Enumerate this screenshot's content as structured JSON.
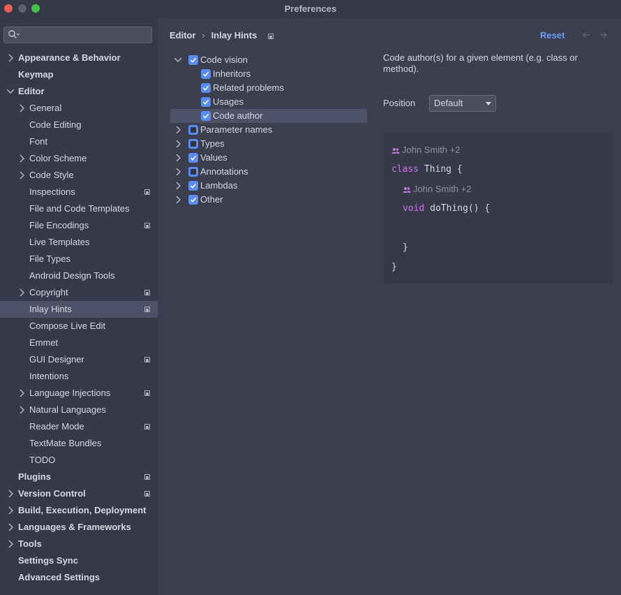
{
  "window": {
    "title": "Preferences"
  },
  "search": {
    "placeholder": ""
  },
  "sidebar": {
    "items": [
      {
        "label": "Appearance & Behavior",
        "bold": true,
        "chevron": "right",
        "level": 0,
        "badge": false,
        "selected": false
      },
      {
        "label": "Keymap",
        "bold": true,
        "chevron": "none",
        "level": 0,
        "badge": false,
        "selected": false
      },
      {
        "label": "Editor",
        "bold": true,
        "chevron": "down",
        "level": 0,
        "badge": false,
        "selected": false
      },
      {
        "label": "General",
        "bold": false,
        "chevron": "right",
        "level": 1,
        "badge": false,
        "selected": false
      },
      {
        "label": "Code Editing",
        "bold": false,
        "chevron": "none",
        "level": 1,
        "badge": false,
        "selected": false
      },
      {
        "label": "Font",
        "bold": false,
        "chevron": "none",
        "level": 1,
        "badge": false,
        "selected": false
      },
      {
        "label": "Color Scheme",
        "bold": false,
        "chevron": "right",
        "level": 1,
        "badge": false,
        "selected": false
      },
      {
        "label": "Code Style",
        "bold": false,
        "chevron": "right",
        "level": 1,
        "badge": false,
        "selected": false
      },
      {
        "label": "Inspections",
        "bold": false,
        "chevron": "none",
        "level": 1,
        "badge": true,
        "selected": false
      },
      {
        "label": "File and Code Templates",
        "bold": false,
        "chevron": "none",
        "level": 1,
        "badge": false,
        "selected": false
      },
      {
        "label": "File Encodings",
        "bold": false,
        "chevron": "none",
        "level": 1,
        "badge": true,
        "selected": false
      },
      {
        "label": "Live Templates",
        "bold": false,
        "chevron": "none",
        "level": 1,
        "badge": false,
        "selected": false
      },
      {
        "label": "File Types",
        "bold": false,
        "chevron": "none",
        "level": 1,
        "badge": false,
        "selected": false
      },
      {
        "label": "Android Design Tools",
        "bold": false,
        "chevron": "none",
        "level": 1,
        "badge": false,
        "selected": false
      },
      {
        "label": "Copyright",
        "bold": false,
        "chevron": "right",
        "level": 1,
        "badge": true,
        "selected": false
      },
      {
        "label": "Inlay Hints",
        "bold": false,
        "chevron": "none",
        "level": 1,
        "badge": true,
        "selected": true
      },
      {
        "label": "Compose Live Edit",
        "bold": false,
        "chevron": "none",
        "level": 1,
        "badge": false,
        "selected": false
      },
      {
        "label": "Emmet",
        "bold": false,
        "chevron": "none",
        "level": 1,
        "badge": false,
        "selected": false
      },
      {
        "label": "GUI Designer",
        "bold": false,
        "chevron": "none",
        "level": 1,
        "badge": true,
        "selected": false
      },
      {
        "label": "Intentions",
        "bold": false,
        "chevron": "none",
        "level": 1,
        "badge": false,
        "selected": false
      },
      {
        "label": "Language Injections",
        "bold": false,
        "chevron": "right",
        "level": 1,
        "badge": true,
        "selected": false
      },
      {
        "label": "Natural Languages",
        "bold": false,
        "chevron": "right",
        "level": 1,
        "badge": false,
        "selected": false
      },
      {
        "label": "Reader Mode",
        "bold": false,
        "chevron": "none",
        "level": 1,
        "badge": true,
        "selected": false
      },
      {
        "label": "TextMate Bundles",
        "bold": false,
        "chevron": "none",
        "level": 1,
        "badge": false,
        "selected": false
      },
      {
        "label": "TODO",
        "bold": false,
        "chevron": "none",
        "level": 1,
        "badge": false,
        "selected": false
      },
      {
        "label": "Plugins",
        "bold": true,
        "chevron": "none",
        "level": 0,
        "badge": true,
        "selected": false
      },
      {
        "label": "Version Control",
        "bold": true,
        "chevron": "right",
        "level": 0,
        "badge": true,
        "selected": false
      },
      {
        "label": "Build, Execution, Deployment",
        "bold": true,
        "chevron": "right",
        "level": 0,
        "badge": false,
        "selected": false
      },
      {
        "label": "Languages & Frameworks",
        "bold": true,
        "chevron": "right",
        "level": 0,
        "badge": false,
        "selected": false
      },
      {
        "label": "Tools",
        "bold": true,
        "chevron": "right",
        "level": 0,
        "badge": false,
        "selected": false
      },
      {
        "label": "Settings Sync",
        "bold": true,
        "chevron": "none",
        "level": 0,
        "badge": false,
        "selected": false
      },
      {
        "label": "Advanced Settings",
        "bold": true,
        "chevron": "none",
        "level": 0,
        "badge": false,
        "selected": false
      }
    ]
  },
  "breadcrumb": {
    "parent": "Editor",
    "separator": "›",
    "current": "Inlay Hints"
  },
  "toolbar": {
    "reset_label": "Reset"
  },
  "hints": [
    {
      "label": "Code vision",
      "chevron": "down",
      "level": 0,
      "state": "checked",
      "selected": false
    },
    {
      "label": "Inheritors",
      "chevron": "none",
      "level": 1,
      "state": "checked",
      "selected": false
    },
    {
      "label": "Related problems",
      "chevron": "none",
      "level": 1,
      "state": "checked",
      "selected": false
    },
    {
      "label": "Usages",
      "chevron": "none",
      "level": 1,
      "state": "checked",
      "selected": false
    },
    {
      "label": "Code author",
      "chevron": "none",
      "level": 1,
      "state": "checked",
      "selected": true
    },
    {
      "label": "Parameter names",
      "chevron": "right",
      "level": 0,
      "state": "partial",
      "selected": false
    },
    {
      "label": "Types",
      "chevron": "right",
      "level": 0,
      "state": "partial",
      "selected": false
    },
    {
      "label": "Values",
      "chevron": "right",
      "level": 0,
      "state": "checked",
      "selected": false
    },
    {
      "label": "Annotations",
      "chevron": "right",
      "level": 0,
      "state": "partial",
      "selected": false
    },
    {
      "label": "Lambdas",
      "chevron": "right",
      "level": 0,
      "state": "checked",
      "selected": false
    },
    {
      "label": "Other",
      "chevron": "right",
      "level": 0,
      "state": "checked",
      "selected": false
    }
  ],
  "details": {
    "description": "Code author(s) for a given element (e.g. class or method).",
    "position_label": "Position",
    "position_value": "Default"
  },
  "preview": {
    "author_hint_1": "John Smith +2",
    "line_class_kw": "class",
    "line_class_rest": " Thing {",
    "author_hint_2": "John Smith +2",
    "line_method_kw": "void",
    "line_method_rest": " doThing() {",
    "line_close_inner": "}",
    "line_close_outer": "}"
  },
  "colors": {
    "accent": "#5a8dee",
    "reset_link": "#6e9df4",
    "keyword": "#c679dd",
    "selection": "#4c5168"
  }
}
